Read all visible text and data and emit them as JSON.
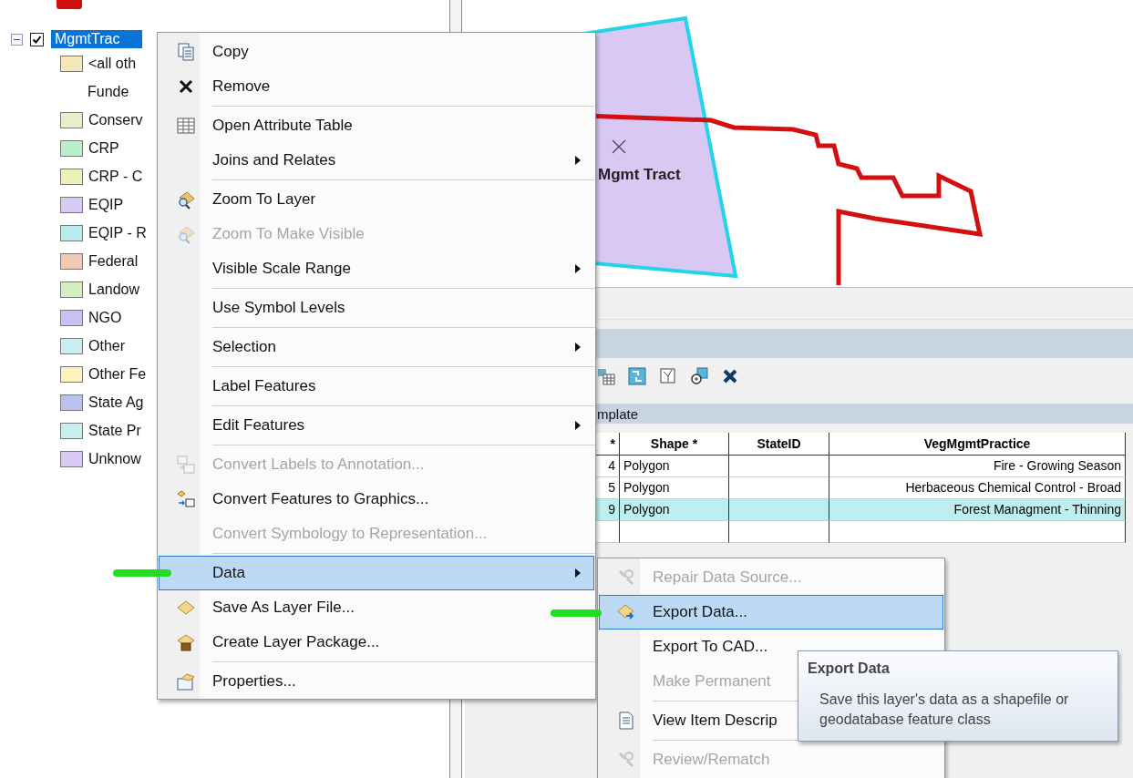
{
  "toc": {
    "layer": {
      "name": "MgmtTrac",
      "checked": true,
      "expanded": true,
      "selected": true
    },
    "legend": [
      {
        "kind": "swatch",
        "label": "<all oth",
        "color": "#f6e7b9"
      },
      {
        "kind": "heading",
        "label": "Funde"
      },
      {
        "kind": "swatch",
        "label": "Conserv",
        "color": "#e5efc9"
      },
      {
        "kind": "swatch",
        "label": "CRP",
        "color": "#b9efc9"
      },
      {
        "kind": "swatch",
        "label": "CRP - C",
        "color": "#edf0b9"
      },
      {
        "kind": "swatch",
        "label": "EQIP",
        "color": "#d9c9f5"
      },
      {
        "kind": "swatch",
        "label": "EQIP - R",
        "color": "#b9ebef"
      },
      {
        "kind": "swatch",
        "label": "Federal",
        "color": "#f4c9b1"
      },
      {
        "kind": "swatch",
        "label": "Landow",
        "color": "#d3efc1"
      },
      {
        "kind": "swatch",
        "label": "NGO",
        "color": "#c9c1f5"
      },
      {
        "kind": "swatch",
        "label": "Other",
        "color": "#c9edf0"
      },
      {
        "kind": "swatch",
        "label": "Other Fe",
        "color": "#fbf3b9"
      },
      {
        "kind": "swatch",
        "label": "State Ag",
        "color": "#b9c1f0"
      },
      {
        "kind": "swatch",
        "label": "State Pr",
        "color": "#c9eef0"
      },
      {
        "kind": "swatch",
        "label": "Unknow",
        "color": "#d9c9f5"
      }
    ]
  },
  "map": {
    "feature_label": "Mgmt Tract"
  },
  "attribute_table": {
    "strip_label": "mplate",
    "columns": [
      "*",
      "Shape *",
      "StateID",
      "VegMgmtPractice"
    ],
    "rows": [
      {
        "id": "4",
        "shape": "Polygon",
        "practice": "Fire - Growing Season",
        "selected": false
      },
      {
        "id": "5",
        "shape": "Polygon",
        "practice": "Herbaceous Chemical Control - Broad",
        "selected": false
      },
      {
        "id": "9",
        "shape": "Polygon",
        "practice": "Forest Managment - Thinning",
        "selected": true
      }
    ]
  },
  "context_menu": {
    "groups": [
      {
        "items": [
          {
            "label": "Copy",
            "disabled": false,
            "submenu": false,
            "selected": false
          },
          {
            "label": "Remove",
            "disabled": false,
            "submenu": false,
            "selected": false
          }
        ]
      },
      {
        "items": [
          {
            "label": "Open Attribute Table",
            "disabled": false,
            "submenu": false,
            "selected": false
          },
          {
            "label": "Joins and Relates",
            "disabled": false,
            "submenu": true,
            "selected": false
          }
        ]
      },
      {
        "items": [
          {
            "label": "Zoom To Layer",
            "disabled": false,
            "submenu": false,
            "selected": false
          },
          {
            "label": "Zoom To Make Visible",
            "disabled": true,
            "submenu": false,
            "selected": false
          },
          {
            "label": "Visible Scale Range",
            "disabled": false,
            "submenu": true,
            "selected": false
          }
        ]
      },
      {
        "items": [
          {
            "label": "Use Symbol Levels",
            "disabled": false,
            "submenu": false,
            "selected": false
          }
        ]
      },
      {
        "items": [
          {
            "label": "Selection",
            "disabled": false,
            "submenu": true,
            "selected": false
          }
        ]
      },
      {
        "items": [
          {
            "label": "Label Features",
            "disabled": false,
            "submenu": false,
            "selected": false
          }
        ]
      },
      {
        "items": [
          {
            "label": "Edit Features",
            "disabled": false,
            "submenu": true,
            "selected": false
          }
        ]
      },
      {
        "items": [
          {
            "label": "Convert Labels to Annotation...",
            "disabled": true,
            "submenu": false,
            "selected": false
          },
          {
            "label": "Convert Features to Graphics...",
            "disabled": false,
            "submenu": false,
            "selected": false
          },
          {
            "label": "Convert Symbology to Representation...",
            "disabled": true,
            "submenu": false,
            "selected": false
          }
        ]
      },
      {
        "items": [
          {
            "label": "Data",
            "disabled": false,
            "submenu": true,
            "selected": true
          },
          {
            "label": "Save As Layer File...",
            "disabled": false,
            "submenu": false,
            "selected": false
          },
          {
            "label": "Create Layer Package...",
            "disabled": false,
            "submenu": false,
            "selected": false
          }
        ]
      },
      {
        "items": [
          {
            "label": "Properties...",
            "disabled": false,
            "submenu": false,
            "selected": false
          }
        ]
      }
    ]
  },
  "data_submenu": {
    "groups": [
      {
        "items": [
          {
            "label": "Repair Data Source...",
            "disabled": true,
            "selected": false
          },
          {
            "label": "Export Data...",
            "disabled": false,
            "selected": true
          },
          {
            "label": "Export To CAD...",
            "disabled": false,
            "selected": false
          },
          {
            "label": "Make Permanent",
            "disabled": true,
            "selected": false
          }
        ]
      },
      {
        "items": [
          {
            "label": "View Item Descrip",
            "disabled": false,
            "selected": false
          }
        ]
      },
      {
        "items": [
          {
            "label": "Review/Rematch",
            "disabled": true,
            "selected": false
          }
        ]
      }
    ]
  },
  "tooltip": {
    "title": "Export Data",
    "text": "Save this layer's data as a shapefile or geodatabase feature class"
  }
}
